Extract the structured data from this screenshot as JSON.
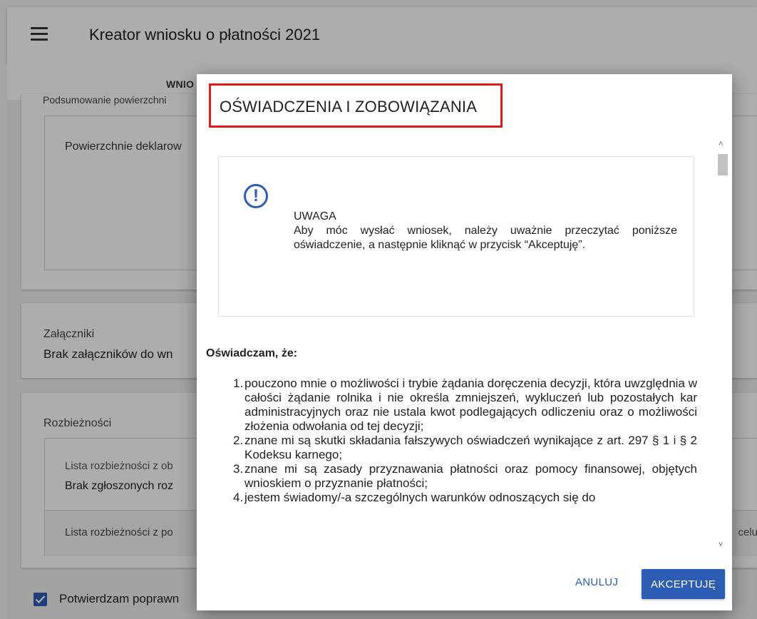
{
  "app": {
    "title": "Kreator wniosku o płatności 2021",
    "tab": "WNIO"
  },
  "background": {
    "summary_sub": "Podsumowanie powierzchni",
    "areas_label": "Powierzchnie deklarow",
    "attachments_label": "Załączniki",
    "attachments_value": "Brak załączników do wn",
    "discrepancies_label": "Rozbieżności",
    "discrepancy_list_1": "Lista rozbieżności z ob",
    "discrepancy_none": "Brak zgłoszonych roz",
    "discrepancy_list_2": "Lista rozbieżności z po",
    "discrepancy_right": "celu",
    "confirm_label": "Potwierdzam poprawn"
  },
  "dialog": {
    "title": "OŚWIADCZENIA I ZOBOWIĄZANIA",
    "notice_heading": "UWAGA",
    "notice_text": "Aby móc wysłać wniosek, należy uważnie przeczytać poniższe oświadczenie, a następnie kliknąć w przycisk “Akceptuję”.",
    "declaration_heading": "Oświadczam, że:",
    "items": [
      {
        "num": "1.",
        "text": "pouczono mnie o możliwości i trybie żądania doręczenia decyzji, która uwzględnia w całości żądanie rolnika i nie określa zmniejszeń, wykluczeń lub pozostałych kar administracyjnych oraz nie ustala kwot podlegających odliczeniu oraz o możliwości złożenia odwołania od tej decyzji;"
      },
      {
        "num": "2.",
        "text": "znane mi są skutki składania fałszywych oświadczeń wynikające z art. 297 § 1 i § 2 Kodeksu karnego;"
      },
      {
        "num": "3.",
        "text": "znane mi są zasady przyznawania płatności oraz pomocy finansowej, objętych wnioskiem o przyznanie płatności;"
      },
      {
        "num": "4.",
        "text": "jestem świadomy/-a szczególnych warunków odnoszących się do"
      }
    ],
    "cancel_label": "ANULUJ",
    "accept_label": "AKCEPTUJĘ"
  },
  "colors": {
    "accent": "#2c5cb4",
    "highlight": "#e4191c"
  }
}
